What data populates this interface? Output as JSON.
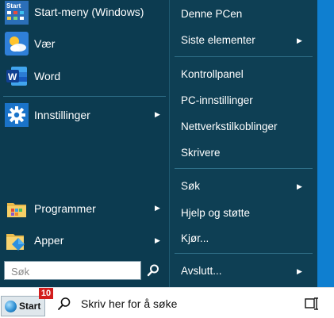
{
  "start_menu": {
    "left_items": [
      {
        "label": "Start-meny (Windows)",
        "icon": "start-menu-app-icon",
        "submenu": false
      },
      {
        "label": "Vær",
        "icon": "weather-icon",
        "submenu": false
      },
      {
        "label": "Word",
        "icon": "word-icon",
        "submenu": false
      },
      {
        "label": "Innstillinger",
        "icon": "settings-gear-icon",
        "submenu": true
      },
      {
        "label": "Programmer",
        "icon": "programs-icon",
        "submenu": true
      },
      {
        "label": "Apper",
        "icon": "apps-folder-icon",
        "submenu": true
      }
    ],
    "start_app_tile_text": "Start",
    "search": {
      "placeholder": "Søk"
    },
    "right_items": [
      {
        "label": "Denne PCen",
        "submenu": false
      },
      {
        "label": "Siste elementer",
        "submenu": true
      },
      {
        "label": "Kontrollpanel",
        "submenu": false
      },
      {
        "label": "PC-innstillinger",
        "submenu": false
      },
      {
        "label": "Nettverkstilkoblinger",
        "submenu": false
      },
      {
        "label": "Skrivere",
        "submenu": false
      },
      {
        "label": "Søk",
        "submenu": true
      },
      {
        "label": "Hjelp og støtte",
        "submenu": false
      },
      {
        "label": "Kjør...",
        "submenu": false
      },
      {
        "label": "Avslutt...",
        "submenu": true
      }
    ],
    "arrow_glyph": "▶"
  },
  "taskbar": {
    "start_label": "Start",
    "badge": "10",
    "search_text": "Skriv her for å søke"
  },
  "colors": {
    "menu_bg": "#0e3f54",
    "desktop": "#1e9be0",
    "badge": "#d21d1d"
  }
}
